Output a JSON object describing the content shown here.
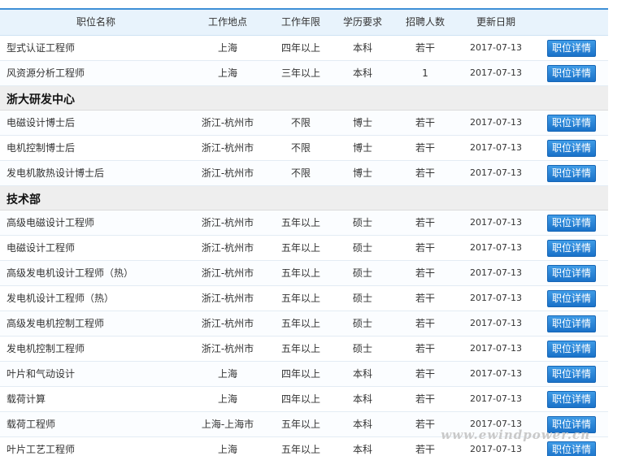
{
  "header": {
    "name": "职位名称",
    "location": "工作地点",
    "experience": "工作年限",
    "education": "学历要求",
    "count": "招聘人数",
    "date": "更新日期"
  },
  "button_label": "职位详情",
  "sections": [
    {
      "dept": "",
      "rows": [
        {
          "name": "型式认证工程师",
          "location": "上海",
          "experience": "四年以上",
          "education": "本科",
          "count": "若干",
          "date": "2017-07-13"
        },
        {
          "name": "风资源分析工程师",
          "location": "上海",
          "experience": "三年以上",
          "education": "本科",
          "count": "1",
          "date": "2017-07-13"
        }
      ]
    },
    {
      "dept": "浙大研发中心",
      "rows": [
        {
          "name": "电磁设计博士后",
          "location": "浙江-杭州市",
          "experience": "不限",
          "education": "博士",
          "count": "若干",
          "date": "2017-07-13"
        },
        {
          "name": "电机控制博士后",
          "location": "浙江-杭州市",
          "experience": "不限",
          "education": "博士",
          "count": "若干",
          "date": "2017-07-13"
        },
        {
          "name": "发电机散热设计博士后",
          "location": "浙江-杭州市",
          "experience": "不限",
          "education": "博士",
          "count": "若干",
          "date": "2017-07-13"
        }
      ]
    },
    {
      "dept": "技术部",
      "rows": [
        {
          "name": "高级电磁设计工程师",
          "location": "浙江-杭州市",
          "experience": "五年以上",
          "education": "硕士",
          "count": "若干",
          "date": "2017-07-13"
        },
        {
          "name": "电磁设计工程师",
          "location": "浙江-杭州市",
          "experience": "五年以上",
          "education": "硕士",
          "count": "若干",
          "date": "2017-07-13"
        },
        {
          "name": "高级发电机设计工程师（热）",
          "location": "浙江-杭州市",
          "experience": "五年以上",
          "education": "硕士",
          "count": "若干",
          "date": "2017-07-13"
        },
        {
          "name": "发电机设计工程师（热）",
          "location": "浙江-杭州市",
          "experience": "五年以上",
          "education": "硕士",
          "count": "若干",
          "date": "2017-07-13"
        },
        {
          "name": "高级发电机控制工程师",
          "location": "浙江-杭州市",
          "experience": "五年以上",
          "education": "硕士",
          "count": "若干",
          "date": "2017-07-13"
        },
        {
          "name": "发电机控制工程师",
          "location": "浙江-杭州市",
          "experience": "五年以上",
          "education": "硕士",
          "count": "若干",
          "date": "2017-07-13"
        },
        {
          "name": "叶片和气动设计",
          "location": "上海",
          "experience": "四年以上",
          "education": "本科",
          "count": "若干",
          "date": "2017-07-13"
        },
        {
          "name": "载荷计算",
          "location": "上海",
          "experience": "四年以上",
          "education": "本科",
          "count": "若干",
          "date": "2017-07-13"
        },
        {
          "name": "载荷工程师",
          "location": "上海-上海市",
          "experience": "五年以上",
          "education": "本科",
          "count": "若干",
          "date": "2017-07-13"
        },
        {
          "name": "叶片工艺工程师",
          "location": "上海",
          "experience": "五年以上",
          "education": "本科",
          "count": "若干",
          "date": "2017-07-13"
        }
      ]
    }
  ],
  "watermark": "www.ewindpower.cn"
}
